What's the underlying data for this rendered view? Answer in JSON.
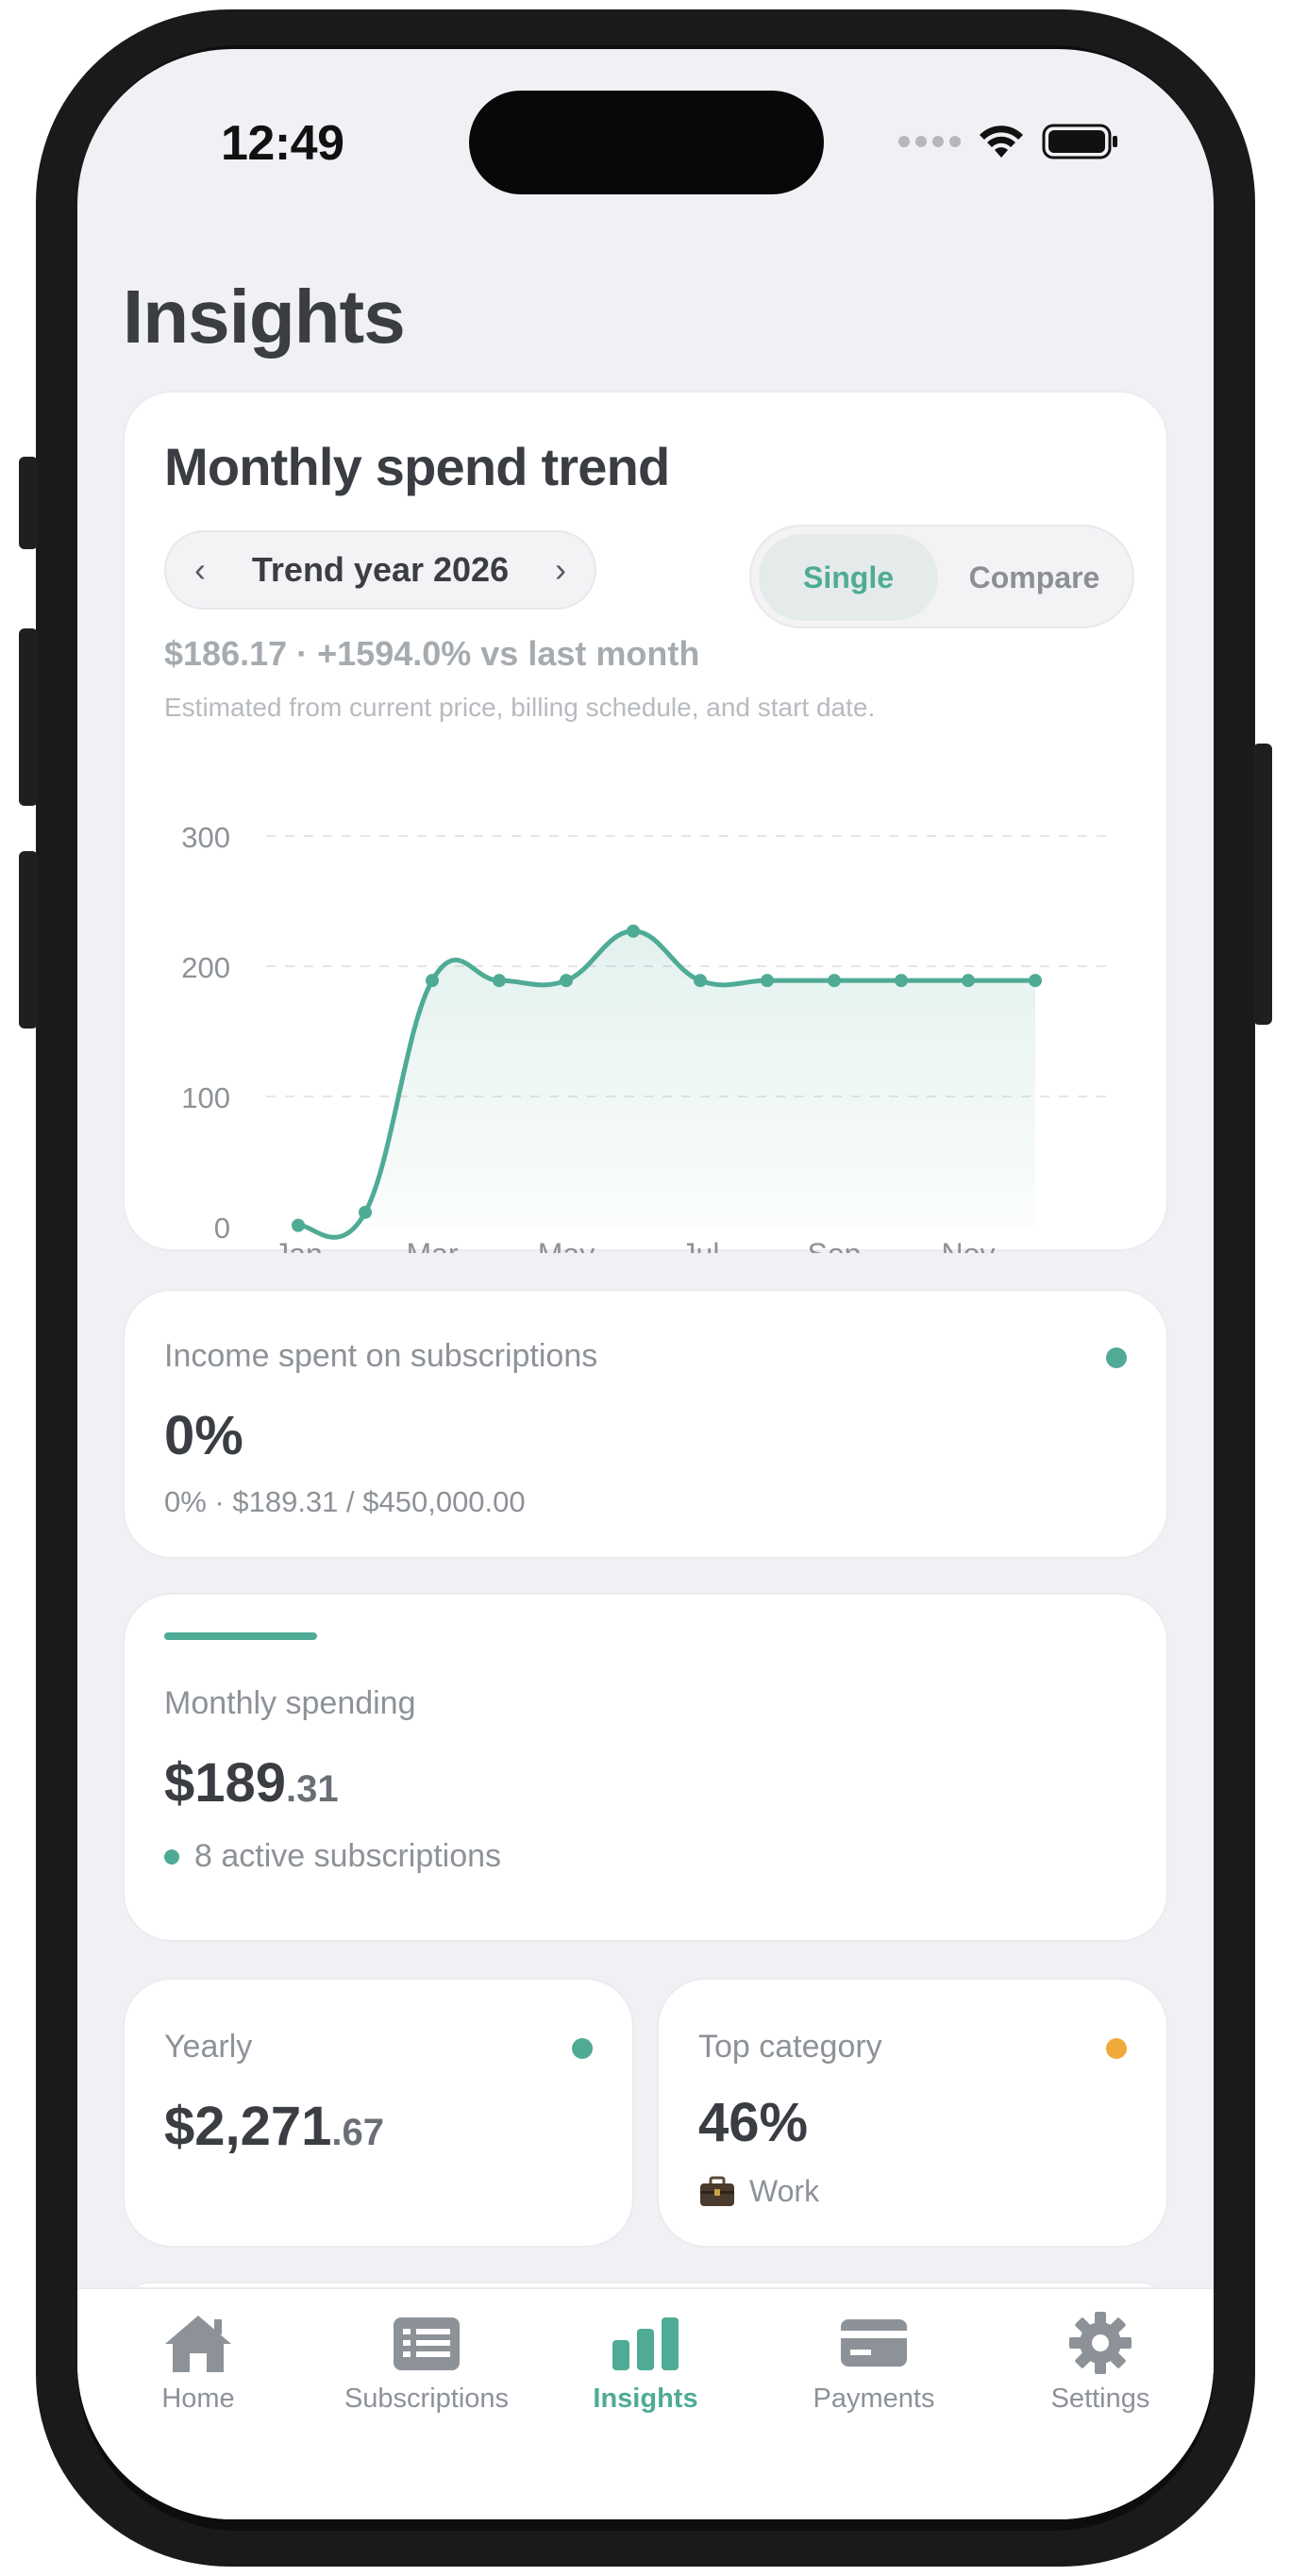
{
  "status_bar": {
    "time": "12:49"
  },
  "page": {
    "title": "Insights"
  },
  "trend": {
    "title": "Monthly spend trend",
    "year_label": "Trend year 2026",
    "mode_options": [
      "Single",
      "Compare"
    ],
    "selected_mode": "Single",
    "summary": "$186.17 · +1594.0% vs last month",
    "note": "Estimated from current price, billing schedule, and start date."
  },
  "chart_data": {
    "type": "line",
    "x": [
      "Jan",
      "Feb",
      "Mar",
      "Apr",
      "May",
      "Jun",
      "Jul",
      "Aug",
      "Sep",
      "Oct",
      "Nov",
      "Dec"
    ],
    "x_tick_labels": [
      "Jan",
      "Mar",
      "May",
      "Jul",
      "Sep",
      "Nov"
    ],
    "y_tick_labels": [
      "0",
      "100",
      "200",
      "300"
    ],
    "series": [
      {
        "values": [
          1,
          11,
          189,
          189,
          189,
          227,
          189,
          189,
          189,
          189,
          189,
          189
        ]
      }
    ],
    "ylim": [
      0,
      300
    ],
    "grid": true,
    "area_fill": true,
    "color": "#4fab95"
  },
  "income": {
    "label": "Income spent on subscriptions",
    "value": "0%",
    "detail": "0% · $189.31 / $450,000.00",
    "dot_color": "#4fab95"
  },
  "monthly": {
    "label": "Monthly spending",
    "value_main": "$189",
    "value_cents": ".31",
    "active": "8 active subscriptions",
    "accent": "#4fab95"
  },
  "yearly": {
    "label": "Yearly",
    "value_main": "$2,271",
    "value_cents": ".67",
    "dot_color": "#4fab95"
  },
  "top_category": {
    "label": "Top category",
    "value": "46%",
    "category_icon": "briefcase-icon",
    "category": "Work",
    "dot_color": "#f0a93b"
  },
  "tabs": [
    {
      "label": "Home",
      "icon": "house-icon",
      "active": false
    },
    {
      "label": "Subscriptions",
      "icon": "list-icon",
      "active": false
    },
    {
      "label": "Insights",
      "icon": "bar-chart-icon",
      "active": true
    },
    {
      "label": "Payments",
      "icon": "card-icon",
      "active": false
    },
    {
      "label": "Settings",
      "icon": "gear-icon",
      "active": false
    }
  ]
}
